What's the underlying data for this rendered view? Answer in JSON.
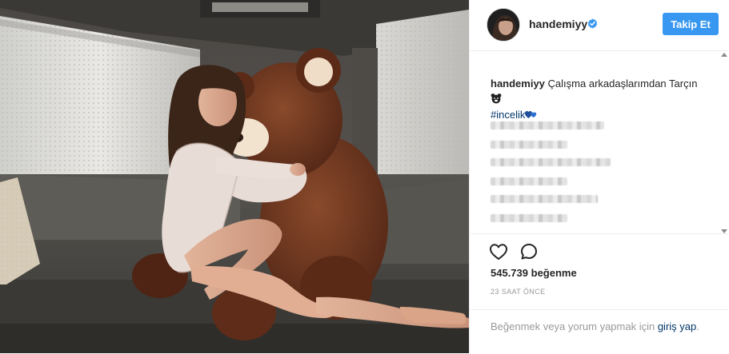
{
  "header": {
    "username": "handemiyy",
    "follow_label": "Takip Et",
    "accent_color": "#3897f0"
  },
  "caption": {
    "username": "handemiyy",
    "text": "Çalışma arkadaşlarımdan Tarçın",
    "emoji": "bear-face-emoji",
    "hashtag": "#incelik",
    "hashtag_emoji": "blue-hearts-emoji"
  },
  "comments": {
    "blurred_count": 6
  },
  "actions": {
    "like_icon": "heart-icon",
    "comment_icon": "speech-bubble-icon",
    "likes_count": "545.739",
    "likes_label": "beğenme",
    "timestamp": "23 SAAT ÖNCE"
  },
  "login": {
    "prompt": "Beğenmek veya yorum yapmak için",
    "link_word_1": "giriş",
    "link_word_2": "yap",
    "trailing": "."
  },
  "colors": {
    "link": "#003569",
    "muted": "#999999",
    "border": "#efefef"
  }
}
